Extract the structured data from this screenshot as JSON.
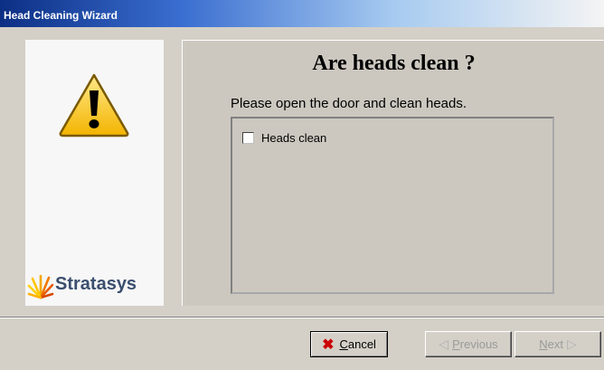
{
  "window": {
    "title": "Head Cleaning Wizard"
  },
  "sidebar": {
    "logo_text": "Stratasys",
    "icon": "warning-icon"
  },
  "main": {
    "heading": "Are heads clean ?",
    "instruction": "Please open the door and clean heads.",
    "checkbox": {
      "label": "Heads clean",
      "checked": false
    }
  },
  "buttons": {
    "cancel": "Cancel",
    "previous": "Previous",
    "next": "Next"
  }
}
